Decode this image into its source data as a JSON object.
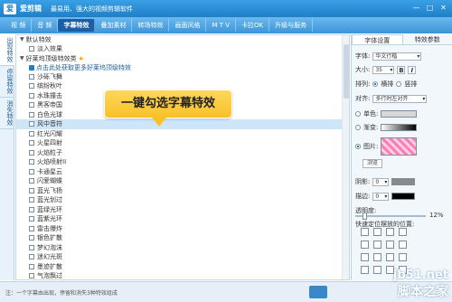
{
  "titlebar": {
    "logo": "爱",
    "app_name": "爱剪辑",
    "slogan": "最易用、强大的视频剪辑软件",
    "min": "—",
    "max": "□",
    "close": "✕"
  },
  "menu": {
    "tabs": [
      "视 频",
      "音 频",
      "字幕特效",
      "叠加素材",
      "转场特效",
      "画面风格",
      "M T V",
      "卡拉OK",
      "升级与服务"
    ],
    "active_index": 2
  },
  "side_tabs": [
    "出现特效",
    "停留特效",
    "消失特效"
  ],
  "list": {
    "default_group": "默认特效",
    "default_items": [
      "淡入效果"
    ],
    "recommended_group": "好莱坞顶级特效类",
    "promo": "点击此处获取更多好莱坞顶级特效",
    "items": [
      "沙砾飞舞",
      "缤纷秋叶",
      "水珠撞击",
      "黑客帝国",
      "白色光球",
      "风中音符",
      "红光闪耀",
      "火星四射",
      "火焰粒子",
      "火焰喷射II",
      "卡通星云",
      "闪爱蝴蝶",
      "蓝光飞扬",
      "蓝光划过",
      "蓝绿光环",
      "蓝紫光环",
      "雷击爆炸",
      "银色扩散",
      "梦幻泡沫",
      "迷幻光斑",
      "墨迹扩散",
      "气泡飘过"
    ],
    "highlight_index": 5
  },
  "callout": "一键勾选字幕特效",
  "settings": {
    "tabs": [
      "字体设置",
      "特效参数"
    ],
    "font_label": "字体:",
    "font_value": "华文行楷",
    "size_label": "大小:",
    "size_value": "35",
    "bold": "B",
    "italic": "I",
    "layout_label": "排列:",
    "horizontal": "横排",
    "vertical": "竖排",
    "align_label": "对齐:",
    "align_value": "多行时左对齐",
    "solid_label": "单色:",
    "gradient_label": "渐变:",
    "image_label": "图片:",
    "browse": "浏览",
    "shadow_label": "阴影:",
    "shadow_value": "0",
    "stroke_label": "描边:",
    "stroke_value": "0",
    "opacity_label": "透明度:",
    "opacity_value": "12%",
    "position_label": "快速定位摆放的位置:",
    "colors": {
      "accent": "#1f7fc6",
      "pink": "#ff7eb6"
    }
  },
  "footer": {
    "note": "注：一个字幕由出现，停留和消失3种特效组成"
  },
  "watermark": {
    "line1": "jb51.net",
    "line2": "脚本之家"
  }
}
